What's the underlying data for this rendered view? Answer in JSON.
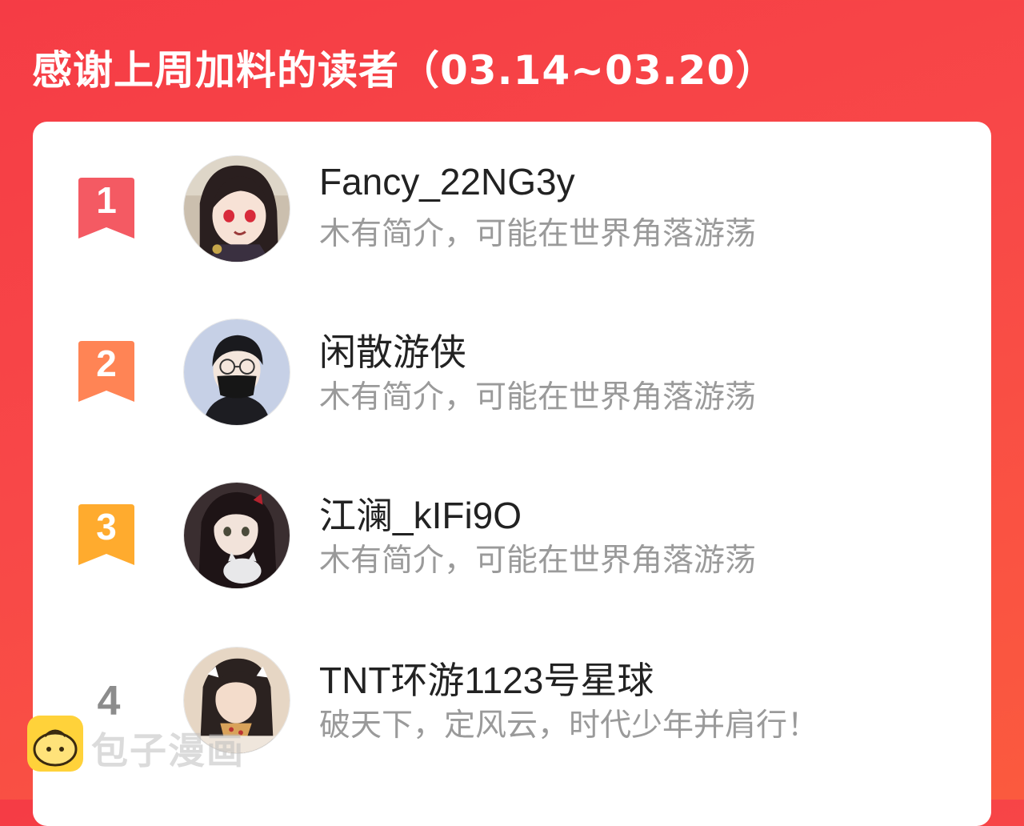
{
  "header": {
    "title": "感谢上周加料的读者（03.14~03.20）"
  },
  "readers": [
    {
      "rank": "1",
      "name": "Fancy_22NG3y",
      "description": "木有简介，可能在世界角落游荡",
      "badge_color": "#f45a63",
      "avatar_icon": "anime-girl-avatar"
    },
    {
      "rank": "2",
      "name": "闲散游侠",
      "description": "木有简介，可能在世界角落游荡",
      "badge_color": "#ff8455",
      "avatar_icon": "masked-boy-avatar"
    },
    {
      "rank": "3",
      "name": "江澜_kIFi9O",
      "description": "木有简介，可能在世界角落游荡",
      "badge_color": "#ffab2e",
      "avatar_icon": "girl-with-cat-avatar"
    },
    {
      "rank": "4",
      "name": "TNT环游1123号星球",
      "description": "破天下，定风云，时代少年并肩行！",
      "avatar_icon": "photo-avatar"
    }
  ],
  "watermark": {
    "text": "包子漫画",
    "icon": "bun-logo-icon"
  }
}
